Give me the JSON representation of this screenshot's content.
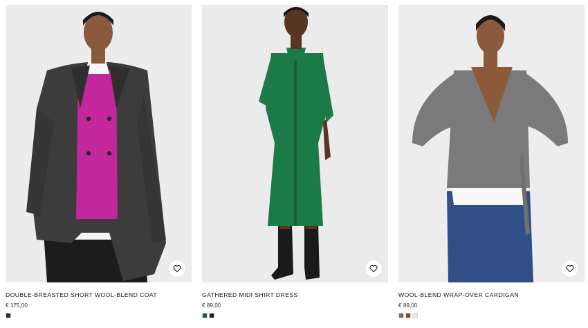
{
  "products": [
    {
      "name": "DOUBLE-BREASTED SHORT WOOL-BLEND COAT",
      "price": "€ 175,00",
      "swatches": [
        "#2b2b2b"
      ],
      "image_icon": "model-wearing-charcoal-coat-icon"
    },
    {
      "name": "GATHERED MIDI SHIRT DRESS",
      "price": "€ 89,00",
      "swatches": [
        "#1f5e3b",
        "#222222"
      ],
      "image_icon": "model-wearing-green-dress-icon"
    },
    {
      "name": "WOOL-BLEND WRAP-OVER CARDIGAN",
      "price": "€ 89,00",
      "swatches": [
        "#6f6f6f",
        "#8a4a1f",
        "#efe6d6"
      ],
      "image_icon": "model-wearing-grey-cardigan-icon"
    }
  ],
  "wishlist_icon": "heart-icon",
  "colors": {
    "image_bg": "#efefef",
    "text": "#111111"
  }
}
